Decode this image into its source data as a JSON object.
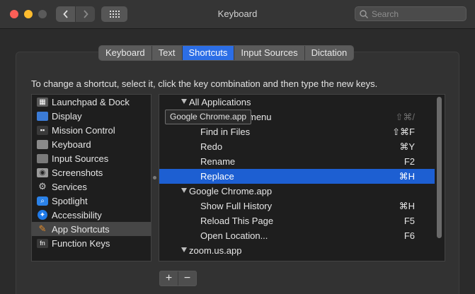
{
  "window": {
    "title": "Keyboard"
  },
  "toolbar": {
    "search_placeholder": "Search"
  },
  "tabs": [
    {
      "label": "Keyboard",
      "active": false
    },
    {
      "label": "Text",
      "active": false
    },
    {
      "label": "Shortcuts",
      "active": true
    },
    {
      "label": "Input Sources",
      "active": false
    },
    {
      "label": "Dictation",
      "active": false
    }
  ],
  "instruction": "To change a shortcut, select it, click the key combination and then type the new keys.",
  "categories": [
    {
      "label": "Launchpad & Dock",
      "icon": "launchpad-icon"
    },
    {
      "label": "Display",
      "icon": "display-icon"
    },
    {
      "label": "Mission Control",
      "icon": "mission-control-icon"
    },
    {
      "label": "Keyboard",
      "icon": "keyboard-icon"
    },
    {
      "label": "Input Sources",
      "icon": "input-sources-icon"
    },
    {
      "label": "Screenshots",
      "icon": "screenshots-icon"
    },
    {
      "label": "Services",
      "icon": "gear-icon"
    },
    {
      "label": "Spotlight",
      "icon": "spotlight-icon"
    },
    {
      "label": "Accessibility",
      "icon": "accessibility-icon"
    },
    {
      "label": "App Shortcuts",
      "icon": "app-shortcuts-icon",
      "selected": true
    },
    {
      "label": "Function Keys",
      "icon": "fn-icon"
    }
  ],
  "shortcuts": [
    {
      "label": "All Applications",
      "key": "",
      "group": true
    },
    {
      "label": "menu",
      "key": "⇧⌘/",
      "group": false,
      "dim": true
    },
    {
      "label": "Find in Files",
      "key": "⇧⌘F",
      "group": false
    },
    {
      "label": "Redo",
      "key": "⌘Y",
      "group": false
    },
    {
      "label": "Rename",
      "key": "F2",
      "group": false
    },
    {
      "label": "Replace",
      "key": "⌘H",
      "group": false,
      "selected": true
    },
    {
      "label": "Google Chrome.app",
      "key": "",
      "group": true
    },
    {
      "label": "Show Full History",
      "key": "⌘H",
      "group": false
    },
    {
      "label": "Reload This Page",
      "key": "F5",
      "group": false
    },
    {
      "label": "Open Location...",
      "key": "F6",
      "group": false
    },
    {
      "label": "zoom.us.app",
      "key": "",
      "group": true
    }
  ],
  "tooltip": "Google Chrome.app",
  "buttons": {
    "add": "+",
    "remove": "−"
  },
  "colors": {
    "accent": "#2c6ee6",
    "selection": "#1d5fd2"
  }
}
